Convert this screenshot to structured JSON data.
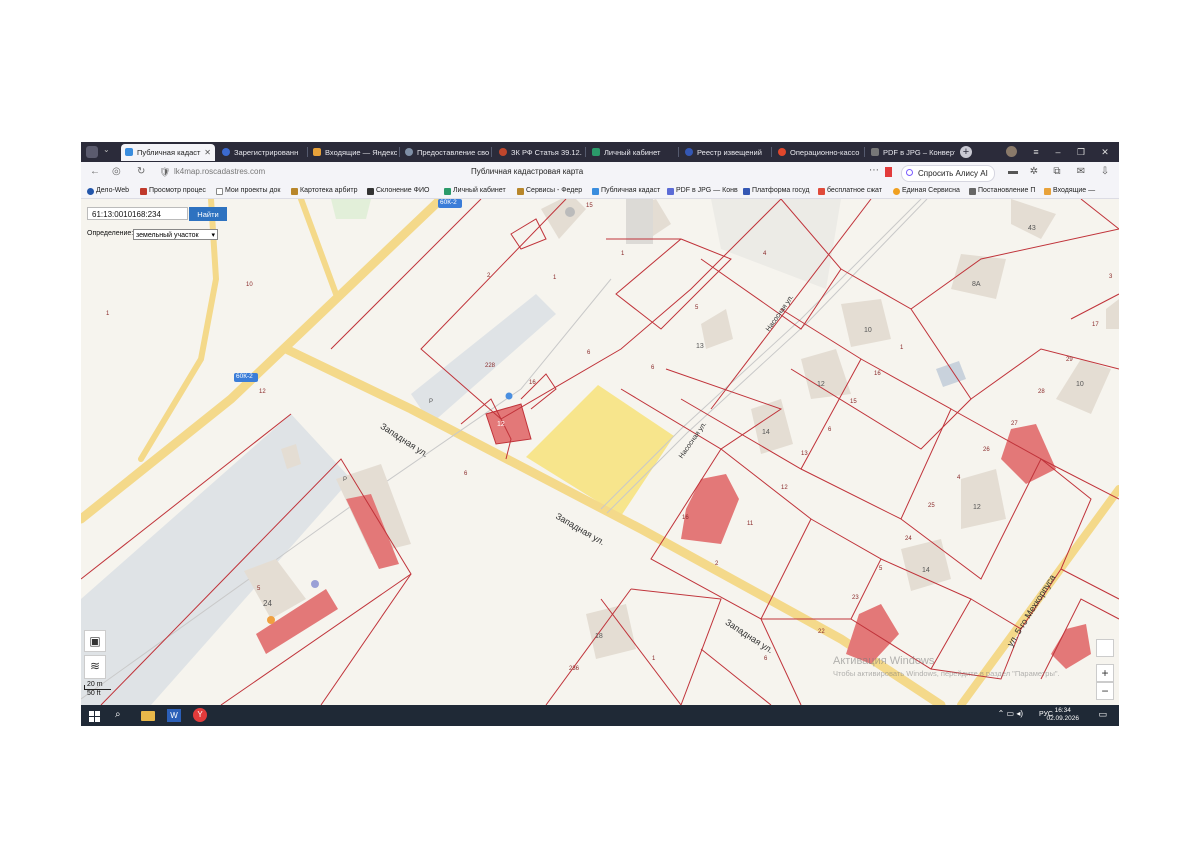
{
  "browser": {
    "tabs": [
      {
        "label": "Публичная кадаст",
        "color": "#3a8dde",
        "active": true
      },
      {
        "label": "Зарегистрированн",
        "color": "#3b6ad0"
      },
      {
        "label": "Входящие — Яндекс",
        "color": "#e8a23a"
      },
      {
        "label": "Предоставление сво",
        "color": "#7f8fa6"
      },
      {
        "label": "ЗК РФ Статья 39.12.",
        "color": "#c0462c"
      },
      {
        "label": "Личный кабинет",
        "color": "#2b9a6a"
      },
      {
        "label": "Реестр извещений",
        "color": "#3457b4"
      },
      {
        "label": "Операционно-кассо",
        "color": "#e0472c"
      },
      {
        "label": "PDF в JPG – Конверт",
        "color": "#777777"
      }
    ],
    "new_tab": "+",
    "url": "lk4map.roscadastres.com",
    "page_title": "Публичная кадастровая карта",
    "alice_label": "Спросить Алису AI",
    "window_controls": [
      "–",
      "❐",
      "✕"
    ],
    "bookmarks": [
      {
        "label": "Дело-Web",
        "color": "#2255aa"
      },
      {
        "label": "Просмотр процес",
        "color": "#c0392b"
      },
      {
        "label": "Мои проекты док",
        "color": "#888888"
      },
      {
        "label": "Картотека арбитр",
        "color": "#b8862a"
      },
      {
        "label": "Склонение ФИО",
        "color": "#333333"
      },
      {
        "label": "Личный кабинет",
        "color": "#2b9a6a"
      },
      {
        "label": "Сервисы - Федер",
        "color": "#b8862a"
      },
      {
        "label": "Публичная кадаст",
        "color": "#3a8dde"
      },
      {
        "label": "PDF в JPG — Конв",
        "color": "#5b6bd6"
      },
      {
        "label": "Платформа госуд",
        "color": "#3457b4"
      },
      {
        "label": "бесплатное сжат",
        "color": "#e04a3a"
      },
      {
        "label": "Единая Сервисна",
        "color": "#f0a020"
      },
      {
        "label": "Постановление П",
        "color": "#666666"
      },
      {
        "label": "Входящие —",
        "color": "#e8a23a"
      }
    ]
  },
  "map": {
    "search_value": "61:13:0010168:234",
    "find_button": "Найти",
    "definition_label": "Определение:",
    "definition_value": "земельный участок",
    "road_badge_top": "60К-2",
    "road_badge_left": "60К-2",
    "street_west": "Западная ул.",
    "street_west2": "Западная ул.",
    "street_west3": "Западная ул.",
    "street_nasos": "Насосная ул.",
    "street_nasos2": "Насосная ул.",
    "street_korpus": "ул. 5-го Мехкорпуса",
    "scale_m": "20 m",
    "scale_ft": "50 ft",
    "zoom_in": "+",
    "zoom_out": "−",
    "watermark": "Активация Windows",
    "watermark_sub": "Чтобы активировать Windows, перейдите в раздел \"Параметры\".",
    "labels": {
      "l1": "1",
      "l10": "10",
      "l2": "2",
      "l1b": "1",
      "l15": "15",
      "l1c": "1",
      "l4": "4",
      "l43": "43",
      "l8a": "8А",
      "l3": "3",
      "l17": "17",
      "l5": "5",
      "l13": "13",
      "l10b": "10",
      "l1d": "1",
      "l16": "16",
      "l228": "228",
      "l16b": "16",
      "l12": "12",
      "l12b": "12",
      "l15b": "15",
      "l29": "29",
      "l10c": "10",
      "l28": "28",
      "l6": "6",
      "l6b": "6",
      "l14": "14",
      "l6c": "6",
      "l13b": "13",
      "l27": "27",
      "l26": "26",
      "l12c": "12",
      "l16c": "16",
      "l11": "11",
      "l12d": "12",
      "l4b": "4",
      "l25": "25",
      "l12e": "12",
      "l6d": "6",
      "l24": "24",
      "l2b": "2",
      "l5b": "5",
      "l14b": "14",
      "l23": "23",
      "l22": "22",
      "l5c": "5",
      "l24b": "24",
      "l18": "18",
      "l236": "236",
      "l1e": "1",
      "l6e": "6",
      "lP": "Р",
      "lP2": "Р",
      "l12f": "12",
      "l2c": "2",
      "l1f": "1"
    }
  },
  "taskbar": {
    "lang": "РУС",
    "time": "16:34",
    "date": "02.09.2026"
  }
}
